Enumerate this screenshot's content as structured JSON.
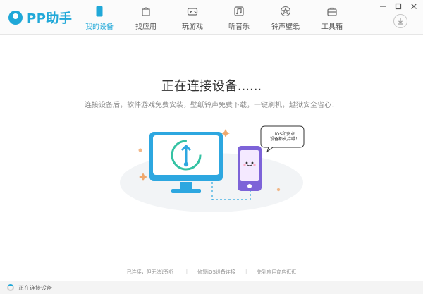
{
  "app": {
    "brand": "PP助手"
  },
  "nav": {
    "tabs": [
      {
        "label": "我的设备",
        "icon": "device-icon",
        "active": true
      },
      {
        "label": "找应用",
        "icon": "bag-icon",
        "active": false
      },
      {
        "label": "玩游戏",
        "icon": "gamepad-icon",
        "active": false
      },
      {
        "label": "听音乐",
        "icon": "music-icon",
        "active": false
      },
      {
        "label": "铃声壁纸",
        "icon": "star-icon",
        "active": false
      },
      {
        "label": "工具箱",
        "icon": "toolbox-icon",
        "active": false
      }
    ]
  },
  "main": {
    "title": "正在连接设备......",
    "subtitle": "连接设备后，软件游戏免费安装，壁纸铃声免费下载，一键刷机，越狱安全省心！",
    "bubble_line1": "iOS和安卓",
    "bubble_line2": "设备都支持哦！",
    "footer_links": [
      "已连接，但无法识别？",
      "修复iOS设备连接",
      "先到应用商店逛逛"
    ]
  },
  "status": {
    "text": "正在连接设备"
  },
  "colors": {
    "accent": "#20a8d8",
    "monitor": "#2da7e0",
    "phone": "#7d63d8",
    "phone_screen": "#f4e9ff",
    "background": "#ffffff"
  }
}
